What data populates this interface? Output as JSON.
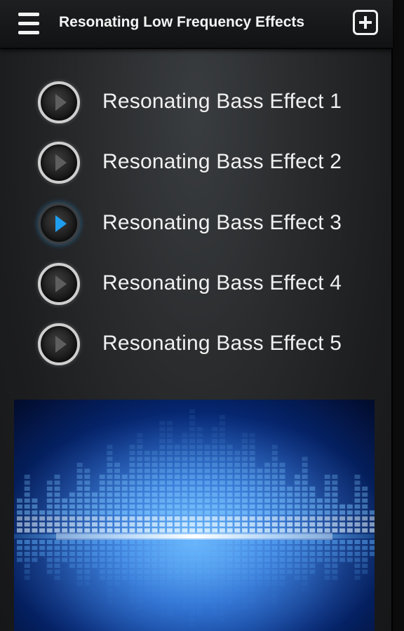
{
  "header": {
    "title": "Resonating Low Frequency Effects",
    "menu_icon": "hamburger-menu-icon",
    "add_icon": "plus-square-icon"
  },
  "tracks": [
    {
      "label": "Resonating Bass Effect 1",
      "active": false
    },
    {
      "label": "Resonating Bass Effect 2",
      "active": false
    },
    {
      "label": "Resonating Bass Effect 3",
      "active": true
    },
    {
      "label": "Resonating Bass Effect 4",
      "active": false
    },
    {
      "label": "Resonating Bass Effect 5",
      "active": false
    }
  ],
  "colors": {
    "accent_play": "#1e9ef0",
    "text": "#f1f1f1",
    "banner_glow": "#2f8ef5",
    "banner_dark": "#020b2a"
  },
  "banner": {
    "image": "blue-equalizer-visualizer-graphic"
  }
}
